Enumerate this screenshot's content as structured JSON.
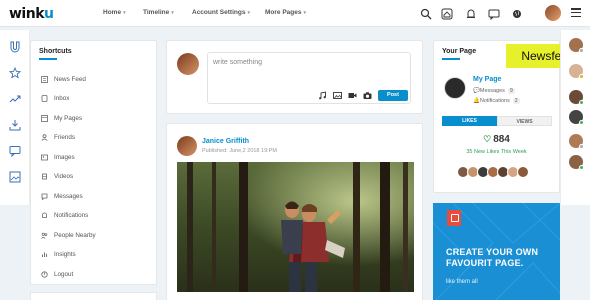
{
  "brand": {
    "logo_text": "winku",
    "accent": "#088dcd"
  },
  "nav": {
    "items": [
      {
        "label": "Home"
      },
      {
        "label": "Timeline"
      },
      {
        "label": "Account Settings"
      },
      {
        "label": "More Pages"
      }
    ],
    "caret": "⌄"
  },
  "topbar_icons": [
    "search-icon",
    "home-icon",
    "bell-icon",
    "message-icon",
    "globe-icon"
  ],
  "rail_icons": [
    "magnet-icon",
    "star-icon",
    "trend-icon",
    "download-icon",
    "chat-icon",
    "image-icon"
  ],
  "shortcuts": {
    "title": "Shortcuts",
    "items": [
      {
        "label": "News Feed",
        "icon": "newsfeed-icon"
      },
      {
        "label": "Inbox",
        "icon": "inbox-icon"
      },
      {
        "label": "My Pages",
        "icon": "pages-icon"
      },
      {
        "label": "Friends",
        "icon": "friends-icon"
      },
      {
        "label": "Images",
        "icon": "image-icon"
      },
      {
        "label": "Videos",
        "icon": "video-icon"
      },
      {
        "label": "Messages",
        "icon": "messages-icon"
      },
      {
        "label": "Notifications",
        "icon": "notification-icon"
      },
      {
        "label": "People Nearby",
        "icon": "people-icon"
      },
      {
        "label": "Insights",
        "icon": "insights-icon"
      },
      {
        "label": "Logout",
        "icon": "logout-icon"
      }
    ]
  },
  "composer": {
    "placeholder": "write something",
    "post_label": "Post",
    "tools": [
      "music-icon",
      "image-icon",
      "video-icon",
      "camera-icon"
    ]
  },
  "post": {
    "author": "Janice Griffith",
    "published": "Published: June,2 2018 19:PM"
  },
  "your_page": {
    "title": "Your Page",
    "page_name": "My Page",
    "messages_label": "Messages",
    "messages_count": "9",
    "notifications_label": "Notifications",
    "notifications_count": "2",
    "tab_likes": "LIKES",
    "tab_views": "VIEWS",
    "likes_total": "884",
    "likes_week": "35 New Likes This Week"
  },
  "tag_label": "Newsfeed",
  "promo": {
    "title": "CREATE YOUR OWN FAVOURIT PAGE.",
    "link": "like them all",
    "color": "#1b8fd4"
  }
}
